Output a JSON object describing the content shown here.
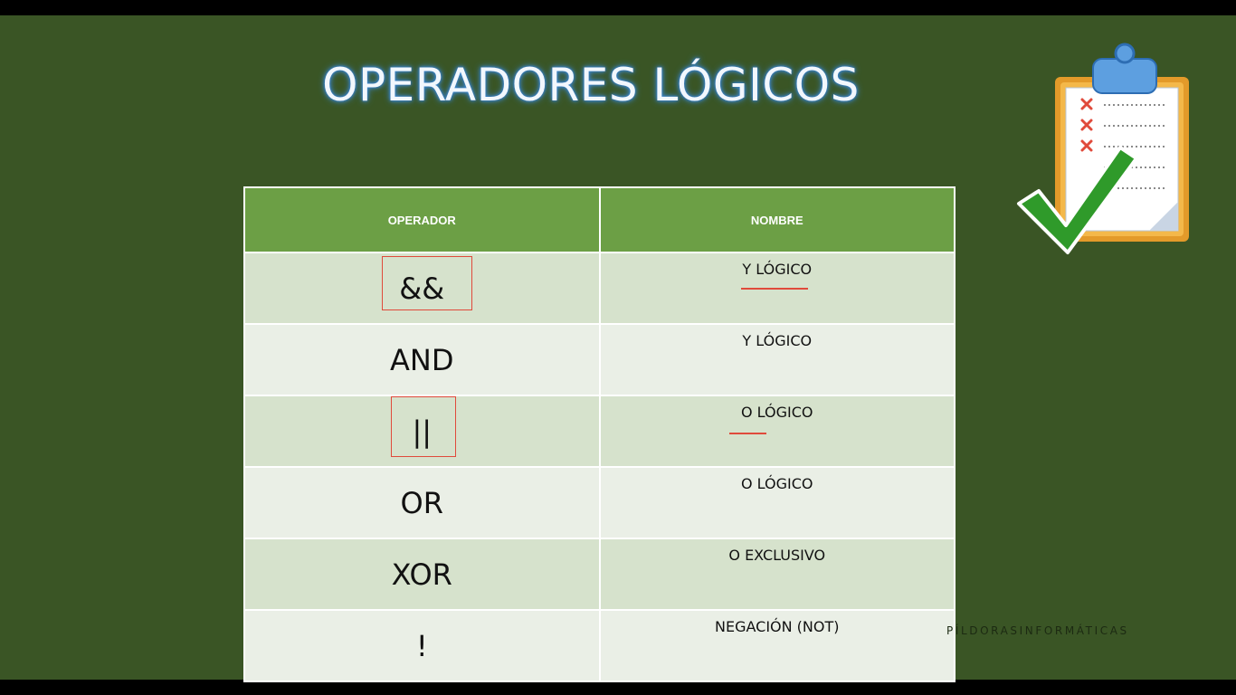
{
  "slide": {
    "title": "OPERADORES LÓGICOS",
    "watermark": "PÍLDORASINFORMÁTICAS"
  },
  "table": {
    "headers": [
      "OPERADOR",
      "NOMBRE"
    ],
    "rows": [
      {
        "operator": "&&",
        "name": "Y LÓGICO"
      },
      {
        "operator": "AND",
        "name": "Y LÓGICO"
      },
      {
        "operator": "||",
        "name": "O LÓGICO"
      },
      {
        "operator": "OR",
        "name": "O LÓGICO"
      },
      {
        "operator": "XOR",
        "name": "O EXCLUSIVO"
      },
      {
        "operator": "!",
        "name": "NEGACIÓN (NOT)"
      }
    ]
  },
  "colors": {
    "background": "#3a5525",
    "header": "#6c9f45",
    "row_odd": "#d6e2cc",
    "row_even": "#eaefe6",
    "annotation": "#e04a3b",
    "title_glow": "#3d8ad8"
  },
  "icons": [
    "clipboard-checklist-icon",
    "green-checkmark-icon"
  ]
}
